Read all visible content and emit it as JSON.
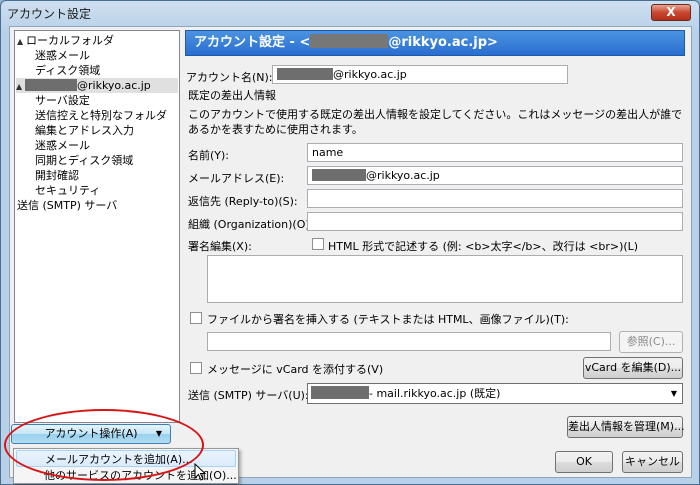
{
  "window": {
    "title": "アカウント設定",
    "close_glyph": "X"
  },
  "tree": {
    "items": [
      {
        "label": "ローカルフォルダ",
        "level": 0,
        "expander": "▲"
      },
      {
        "label": "迷惑メール",
        "level": 1
      },
      {
        "label": "ディスク領域",
        "level": 1
      },
      {
        "label": "@rikkyo.ac.jp",
        "level": 0,
        "expander": "▲",
        "redacted": true,
        "selected": true
      },
      {
        "label": "サーバ設定",
        "level": 1
      },
      {
        "label": "送信控えと特別なフォルダ",
        "level": 1
      },
      {
        "label": "編集とアドレス入力",
        "level": 1
      },
      {
        "label": "迷惑メール",
        "level": 1
      },
      {
        "label": "同期とディスク領域",
        "level": 1
      },
      {
        "label": "開封確認",
        "level": 1
      },
      {
        "label": "セキュリティ",
        "level": 1
      },
      {
        "label": "送信 (SMTP) サーバ",
        "level": 0
      }
    ]
  },
  "header": {
    "prefix": "アカウント設定 - <",
    "suffix": "@rikkyo.ac.jp>"
  },
  "account_name": {
    "label": "アカウント名(N):",
    "value": "@rikkyo.ac.jp"
  },
  "identity": {
    "section_title": "既定の差出人情報",
    "description": "このアカウントで使用する既定の差出人情報を設定してください。これはメッセージの差出人が誰であるかを表すために使用されます。",
    "name_label": "名前(Y):",
    "name_value": "name",
    "email_label": "メールアドレス(E):",
    "email_value": "@rikkyo.ac.jp",
    "reply_label": "返信先 (Reply-to)(S):",
    "org_label": "組織 (Organization)(O):",
    "sig_label": "署名編集(X):",
    "html_checkbox_label": "HTML 形式で記述する (例: <b>太字</b>、改行は <br>)(L)",
    "sigfile_checkbox_label": "ファイルから署名を挿入する (テキストまたは HTML、画像ファイル)(T):",
    "browse_label": "参照(C)...",
    "vcard_checkbox_label": "メッセージに vCard を添付する(V)",
    "vcard_edit_label": "vCard を編集(D)...",
    "smtp_label": "送信 (SMTP) サーバ(U):",
    "smtp_value": "- mail.rikkyo.ac.jp (既定)",
    "manage_label": "差出人情報を管理(M)..."
  },
  "footer": {
    "account_actions_label": "アカウント操作(A)",
    "ok_label": "OK",
    "cancel_label": "キャンセル"
  },
  "menu": {
    "items": [
      {
        "label": "メールアカウントを追加(A)..."
      },
      {
        "label": "他のサービスのアカウントを追加(O)..."
      }
    ]
  },
  "colors": {
    "header_bg": "#2a6ed0",
    "annotation_red": "#d81515"
  }
}
